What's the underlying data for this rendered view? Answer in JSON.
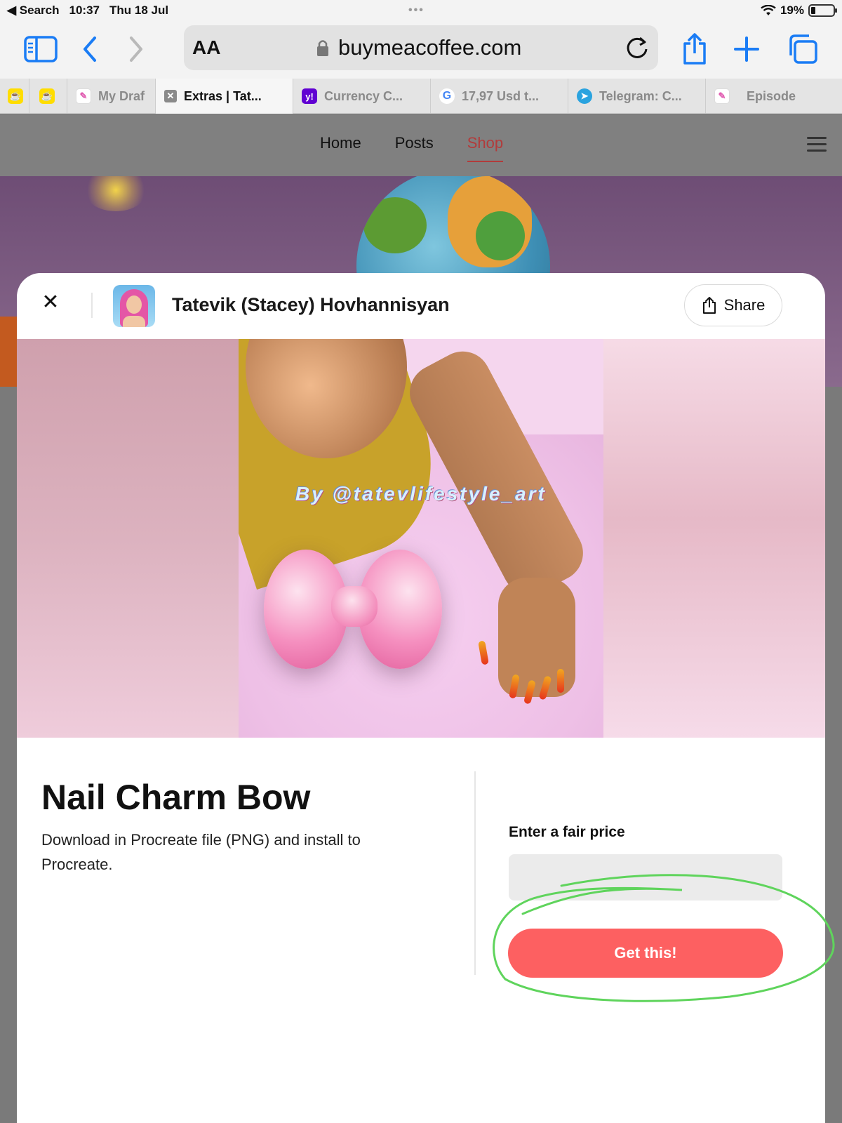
{
  "status_bar": {
    "back_app": "◀ Search",
    "time": "10:37",
    "date": "Thu 18 Jul",
    "battery": "19%"
  },
  "toolbar": {
    "text_size_label": "AA",
    "url": "buymeacoffee.com"
  },
  "tabs": [
    {
      "label": "",
      "icon": "buymeacoffee-icon"
    },
    {
      "label": "",
      "icon": "buymeacoffee-icon"
    },
    {
      "label": "My Draf",
      "icon": "procreate-icon"
    },
    {
      "label": "Extras | Tat...",
      "icon": "close-tab-icon"
    },
    {
      "label": "Currency C...",
      "icon": "yahoo-icon"
    },
    {
      "label": "17,97 Usd t...",
      "icon": "google-icon"
    },
    {
      "label": "Telegram: C...",
      "icon": "telegram-icon"
    },
    {
      "label": "Episode",
      "icon": "procreate-icon"
    }
  ],
  "site_nav": {
    "links": [
      "Home",
      "Posts",
      "Shop"
    ],
    "active": "Shop"
  },
  "modal": {
    "creator_name": "Tatevik (Stacey) Hovhannisyan",
    "share_label": "Share",
    "watermark": "By @tatevlifestyle_art",
    "product_title": "Nail Charm Bow",
    "product_description": "Download in Procreate file (PNG) and install to Procreate.",
    "price_label": "Enter a fair price",
    "price_value": "",
    "cta_label": "Get this!"
  },
  "colors": {
    "accent": "#fd6061",
    "nav_active": "#b23b3b",
    "annotation": "#5fd45c"
  }
}
